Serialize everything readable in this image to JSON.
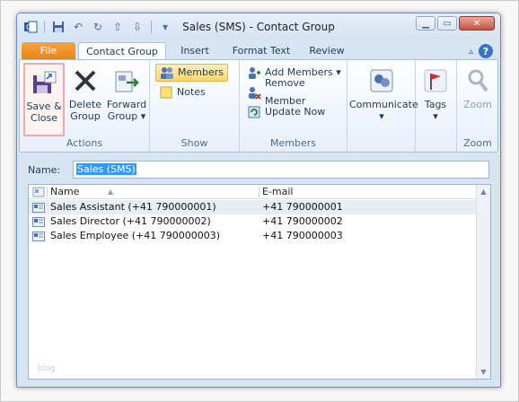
{
  "window": {
    "title": "Sales (SMS)  -  Contact Group"
  },
  "tabs": {
    "file": "File",
    "contact_group": "Contact Group",
    "insert": "Insert",
    "format_text": "Format Text",
    "review": "Review"
  },
  "ribbon": {
    "actions": {
      "label": "Actions",
      "save_close": [
        "Save &",
        "Close"
      ],
      "delete_group": [
        "Delete",
        "Group"
      ],
      "forward_group": [
        "Forward",
        "Group ▾"
      ]
    },
    "show": {
      "label": "Show",
      "members": "Members",
      "notes": "Notes"
    },
    "members": {
      "label": "Members",
      "add_members": "Add Members ▾",
      "remove_member": "Remove Member",
      "update_now": "Update Now"
    },
    "communicate": {
      "label": "Communicate",
      "caret": "▾"
    },
    "tags": {
      "label": "Tags",
      "caret": "▾"
    },
    "zoom": {
      "label": "Zoom",
      "button": "Zoom"
    }
  },
  "form": {
    "name_label": "Name:",
    "name_value": "Sales (SMS)"
  },
  "list": {
    "columns": {
      "name": "Name",
      "email": "E-mail"
    },
    "rows": [
      {
        "name": "Sales Assistant (+41 790000001)",
        "email": "+41 790000001"
      },
      {
        "name": "Sales Director (+41 790000002)",
        "email": "+41 790000002"
      },
      {
        "name": "Sales Employee (+41 790000003)",
        "email": "+41 790000003"
      }
    ],
    "watermark": "blog"
  },
  "colors": {
    "file_tab": "#e98118",
    "selection": "#3399ff",
    "highlight_border": "#f0a9a9"
  }
}
